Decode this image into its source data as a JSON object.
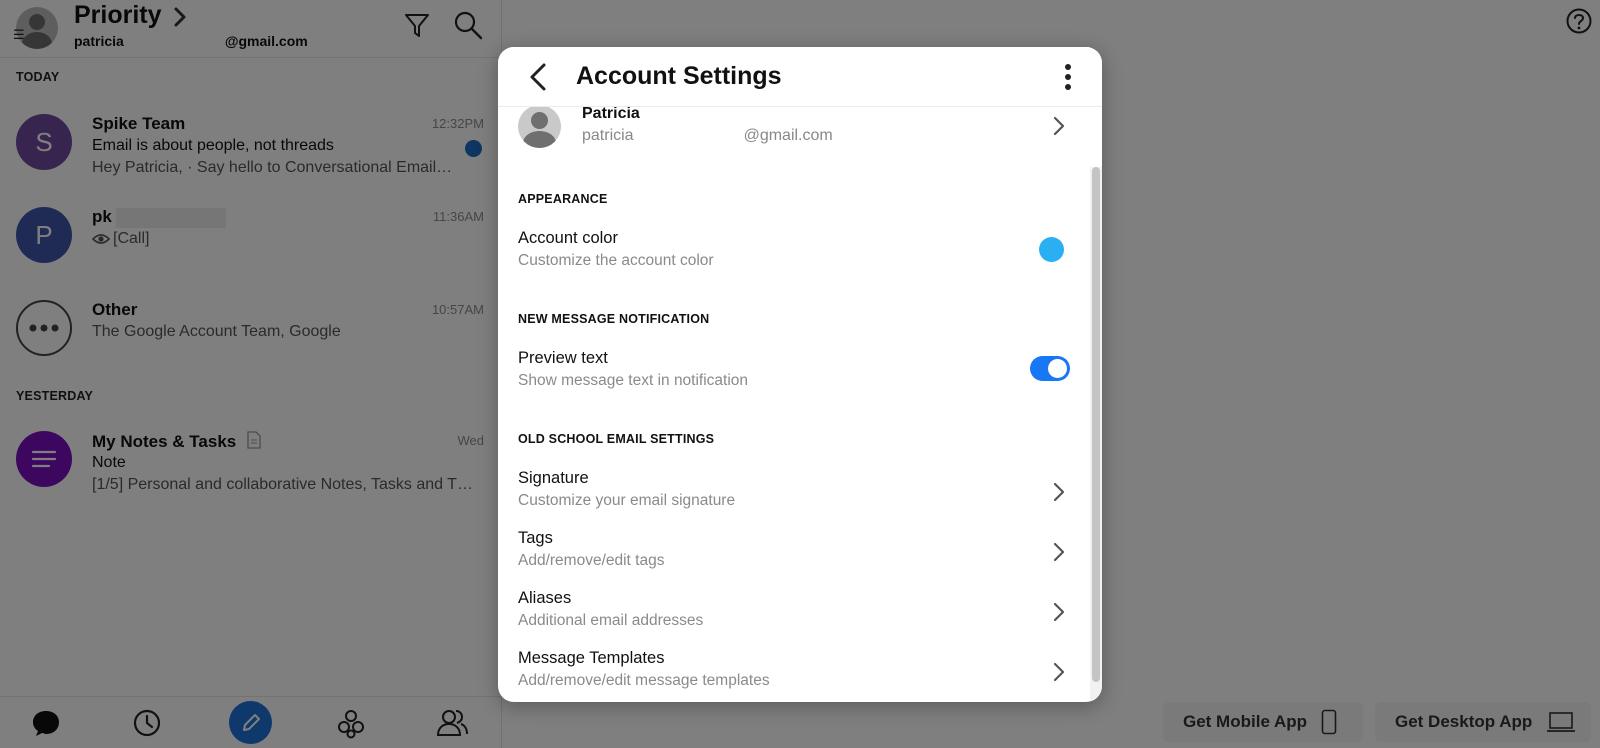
{
  "inbox": {
    "title": "Priority",
    "account_email_user": "patricia",
    "account_email_domain": "@gmail.com",
    "sections": {
      "today": "TODAY",
      "yesterday": "YESTERDAY"
    },
    "threads": [
      {
        "avatar_letter": "S",
        "avatar_color": "#6f4aa0",
        "sender": "Spike Team",
        "time": "12:32PM",
        "subject": "Email is about people, not threads",
        "preview": "Hey Patricia, · Say hello to Conversational Email…",
        "unread": true
      },
      {
        "avatar_letter": "P",
        "avatar_color": "#3e56a8",
        "sender": "pk",
        "time": "11:36AM",
        "subject": "[Call]"
      },
      {
        "avatar_letter": "",
        "sender": "Other",
        "time": "10:57AM",
        "subject": "The Google Account Team, Google"
      },
      {
        "avatar_color": "#7a0fbf",
        "sender": "My Notes & Tasks",
        "time": "Wed",
        "subject": "Note",
        "preview": "[1/5] Personal and collaborative Notes, Tasks and T…"
      }
    ]
  },
  "bottom_nav": {
    "icons": [
      "chat-icon",
      "clock-icon",
      "compose-icon",
      "groups-icon",
      "contacts-icon"
    ]
  },
  "promo": {
    "mobile_label": "Get Mobile App",
    "desktop_label": "Get Desktop App"
  },
  "modal": {
    "title": "Account Settings",
    "profile": {
      "name": "Patricia",
      "email_user": "patricia",
      "email_domain": "@gmail.com"
    },
    "groups": {
      "appearance": "APPEARANCE",
      "notification": "NEW MESSAGE NOTIFICATION",
      "old_school": "OLD SCHOOL EMAIL SETTINGS"
    },
    "account_color": {
      "title": "Account color",
      "desc": "Customize the account color",
      "color": "#2ab0f2"
    },
    "preview_text": {
      "title": "Preview text",
      "desc": "Show message text in notification",
      "enabled": true
    },
    "signature": {
      "title": "Signature",
      "desc": "Customize your email signature"
    },
    "tags": {
      "title": "Tags",
      "desc": "Add/remove/edit tags"
    },
    "aliases": {
      "title": "Aliases",
      "desc": "Additional email addresses"
    },
    "templates": {
      "title": "Message Templates",
      "desc": "Add/remove/edit message templates"
    }
  }
}
